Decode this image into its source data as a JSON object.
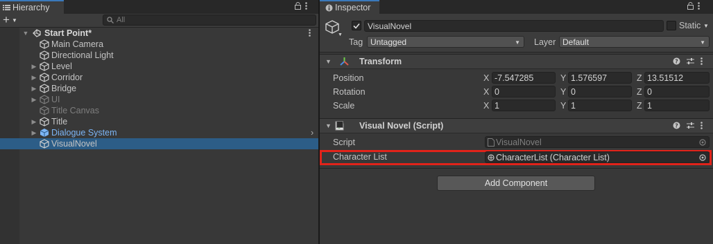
{
  "hierarchy": {
    "tab_label": "Hierarchy",
    "add_label": "+",
    "search_placeholder": "All",
    "scene_name": "Start Point*",
    "items": [
      {
        "label": "Main Camera",
        "state": "normal"
      },
      {
        "label": "Directional Light",
        "state": "normal"
      },
      {
        "label": "Level",
        "state": "normal"
      },
      {
        "label": "Corridor",
        "state": "normal"
      },
      {
        "label": "Bridge",
        "state": "normal"
      },
      {
        "label": "UI",
        "state": "inactive"
      },
      {
        "label": "Title Canvas",
        "state": "inactive"
      },
      {
        "label": "Title",
        "state": "normal"
      },
      {
        "label": "Dialogue System",
        "state": "prefab"
      },
      {
        "label": "VisualNovel",
        "state": "selected"
      }
    ]
  },
  "inspector": {
    "tab_label": "Inspector",
    "object_name": "VisualNovel",
    "static_label": "Static",
    "tag_label": "Tag",
    "tag_value": "Untagged",
    "layer_label": "Layer",
    "layer_value": "Default",
    "transform": {
      "title": "Transform",
      "position_label": "Position",
      "rotation_label": "Rotation",
      "scale_label": "Scale",
      "axis_x": "X",
      "axis_y": "Y",
      "axis_z": "Z",
      "position": {
        "x": "-7.547285",
        "y": "1.576597",
        "z": "13.51512"
      },
      "rotation": {
        "x": "0",
        "y": "0",
        "z": "0"
      },
      "scale": {
        "x": "1",
        "y": "1",
        "z": "1"
      }
    },
    "script_component": {
      "title": "Visual Novel (Script)",
      "script_label": "Script",
      "script_value": "VisualNovel",
      "character_list_label": "Character List",
      "character_list_value": "CharacterList (Character List)"
    },
    "add_component_label": "Add Component"
  },
  "colors": {
    "selection": "#2c5d87",
    "highlight_box": "#e2231a",
    "prefab_text": "#7cb5f5",
    "tab_accent": "#3a79bb"
  }
}
